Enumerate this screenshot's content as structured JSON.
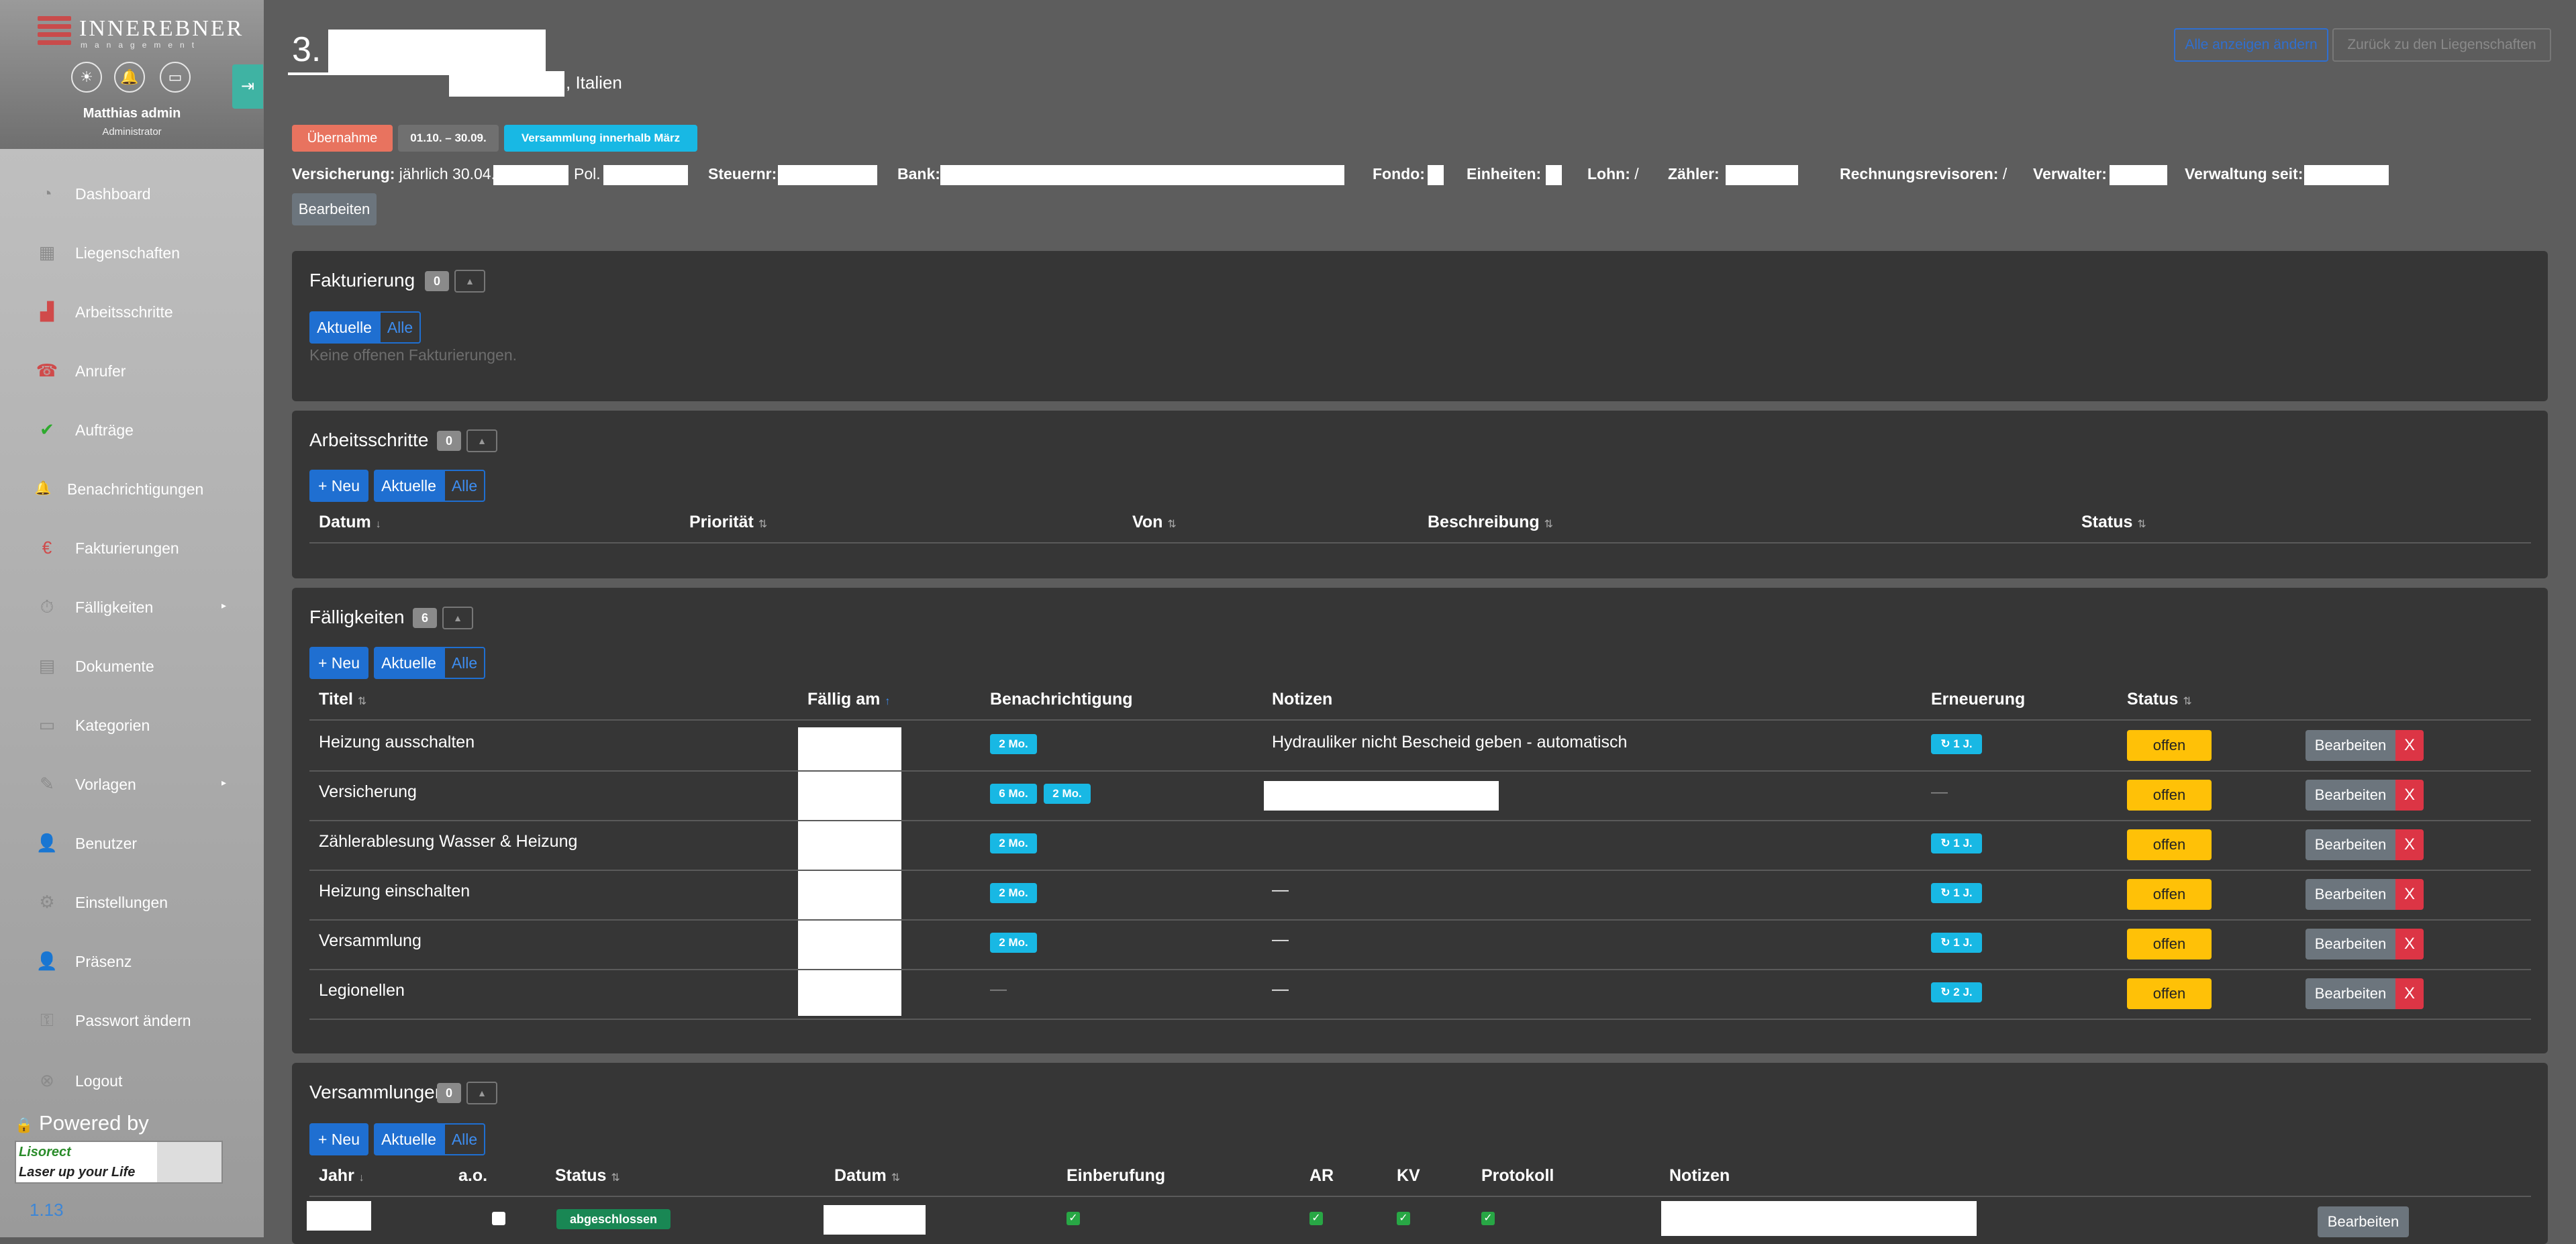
{
  "brand": {
    "name": "INNEREBNER",
    "tagline": "management"
  },
  "user": {
    "name": "Matthias admin",
    "role": "Administrator"
  },
  "sidebar": {
    "items": [
      {
        "label": "Dashboard",
        "icon": "dashboard-icon",
        "glyph": "◔"
      },
      {
        "label": "Liegenschaften",
        "icon": "building-icon",
        "glyph": "▦"
      },
      {
        "label": "Arbeitsschritte",
        "icon": "steps-icon",
        "glyph": "▟"
      },
      {
        "label": "Anrufer",
        "icon": "phone-icon",
        "glyph": "☎"
      },
      {
        "label": "Aufträge",
        "icon": "checkmark-icon",
        "glyph": "✔"
      },
      {
        "label": "Benachrichtigungen",
        "icon": "bell-icon",
        "glyph": "🔔"
      },
      {
        "label": "Fakturierungen",
        "icon": "euro-icon",
        "glyph": "€"
      },
      {
        "label": "Fälligkeiten",
        "icon": "stopwatch-icon",
        "glyph": "⏱",
        "arrow": "▸"
      },
      {
        "label": "Dokumente",
        "icon": "document-icon",
        "glyph": "▤"
      },
      {
        "label": "Kategorien",
        "icon": "category-icon",
        "glyph": "▭"
      },
      {
        "label": "Vorlagen",
        "icon": "template-icon",
        "glyph": "✎",
        "arrow": "▸"
      },
      {
        "label": "Benutzer",
        "icon": "user-icon",
        "glyph": "👤"
      },
      {
        "label": "Einstellungen",
        "icon": "gear-icon",
        "glyph": "⚙"
      },
      {
        "label": "Präsenz",
        "icon": "presence-icon",
        "glyph": "👤"
      },
      {
        "label": "Passwort ändern",
        "icon": "key-icon",
        "glyph": "⚿"
      },
      {
        "label": "Logout",
        "icon": "logout-icon",
        "glyph": "⊗"
      }
    ],
    "powered_by": "Powered by",
    "partner_line1": "Lisorect",
    "partner_line2": "Laser up your Life",
    "version": "1.13"
  },
  "header": {
    "title_number": "3.",
    "subtitle_suffix": ", Italien",
    "btn_primary": "Alle anzeigen ändern",
    "btn_back": "Zurück zu den Liegenschaften",
    "pill_uebernahme": "Übernahme",
    "pill_period": "01.10. – 30.09.",
    "pill_versammlung": "Versammlung innerhalb März",
    "info": {
      "versicherung_label": "Versicherung:",
      "versicherung_value": "jährlich 30.04.",
      "pol_label": "Pol.",
      "steuernr_label": "Steuernr:",
      "bank_label": "Bank:",
      "fondo_label": "Fondo:",
      "einheiten_label": "Einheiten:",
      "lohn_label": "Lohn:",
      "lohn_value": "/",
      "zaehler_label": "Zähler:",
      "revisoren_label": "Rechnungsrevisoren:",
      "revisoren_value": "/",
      "verwalter_label": "Verwalter:",
      "verwaltung_label": "Verwaltung seit:"
    },
    "edit_label": "Bearbeiten"
  },
  "fakturierung": {
    "title": "Fakturierung",
    "count": "0",
    "collapse": "▲",
    "btn_current": "Aktuelle",
    "btn_all": "Alle",
    "empty": "Keine offenen Fakturierungen."
  },
  "arbeitsschritte": {
    "title": "Arbeitsschritte",
    "count": "0",
    "collapse": "▲",
    "btn_new": "+ Neu",
    "btn_current": "Aktuelle",
    "btn_all": "Alle",
    "columns": [
      "Datum",
      "Priorität",
      "Von",
      "Beschreibung",
      "Status"
    ],
    "sort_datum": "↓",
    "sort": "⇅"
  },
  "faelligkeiten": {
    "title": "Fälligkeiten",
    "count": "6",
    "collapse": "▲",
    "btn_new": "+ Neu",
    "btn_current": "Aktuelle",
    "btn_all": "Alle",
    "columns": [
      "Titel",
      "Fällig am",
      "Benachrichtigung",
      "Notizen",
      "Erneuerung",
      "Status"
    ],
    "sort": "⇅",
    "sort_faellig": "↑",
    "rows": [
      {
        "title": "Heizung ausschalten",
        "notify": [
          "2 Mo."
        ],
        "notes": "Hydrauliker nicht Bescheid geben - automatisch",
        "renew": "↻ 1 J.",
        "status": "offen"
      },
      {
        "title": "Versicherung",
        "notify": [
          "6 Mo.",
          "2 Mo."
        ],
        "notes": "",
        "renew": "—",
        "status": "offen"
      },
      {
        "title": "Zählerablesung Wasser & Heizung",
        "notify": [
          "2 Mo."
        ],
        "notes": "",
        "renew": "↻ 1 J.",
        "status": "offen"
      },
      {
        "title": "Heizung einschalten",
        "notify": [
          "2 Mo."
        ],
        "notes": "—",
        "renew": "↻ 1 J.",
        "status": "offen"
      },
      {
        "title": "Versammlung",
        "notify": [
          "2 Mo."
        ],
        "notes": "—",
        "renew": "↻ 1 J.",
        "status": "offen"
      },
      {
        "title": "Legionellen",
        "notify": [
          "—"
        ],
        "notes": "—",
        "renew": "↻ 2 J.",
        "status": "offen"
      }
    ],
    "edit_label": "Bearbeiten",
    "delete_label": "X"
  },
  "versammlungen": {
    "title": "Versammlungen",
    "count": "0",
    "collapse": "▲",
    "btn_new": "+ Neu",
    "btn_current": "Aktuelle",
    "btn_all": "Alle",
    "columns": [
      "Jahr",
      "a.o.",
      "Status",
      "Datum",
      "Einberufung",
      "AR",
      "KV",
      "Protokoll",
      "Notizen"
    ],
    "sort_jahr": "↓",
    "sort": "⇅",
    "row": {
      "status": "abgeschlossen",
      "check": "✓",
      "edit_label": "Bearbeiten"
    }
  },
  "colors": {
    "accent_blue": "#1f6fd1",
    "cyan": "#18b8e4",
    "warning": "#ffc107",
    "danger": "#dc3545",
    "salmon": "#e8735f",
    "success": "#198754",
    "teal": "#3fb3a3"
  }
}
